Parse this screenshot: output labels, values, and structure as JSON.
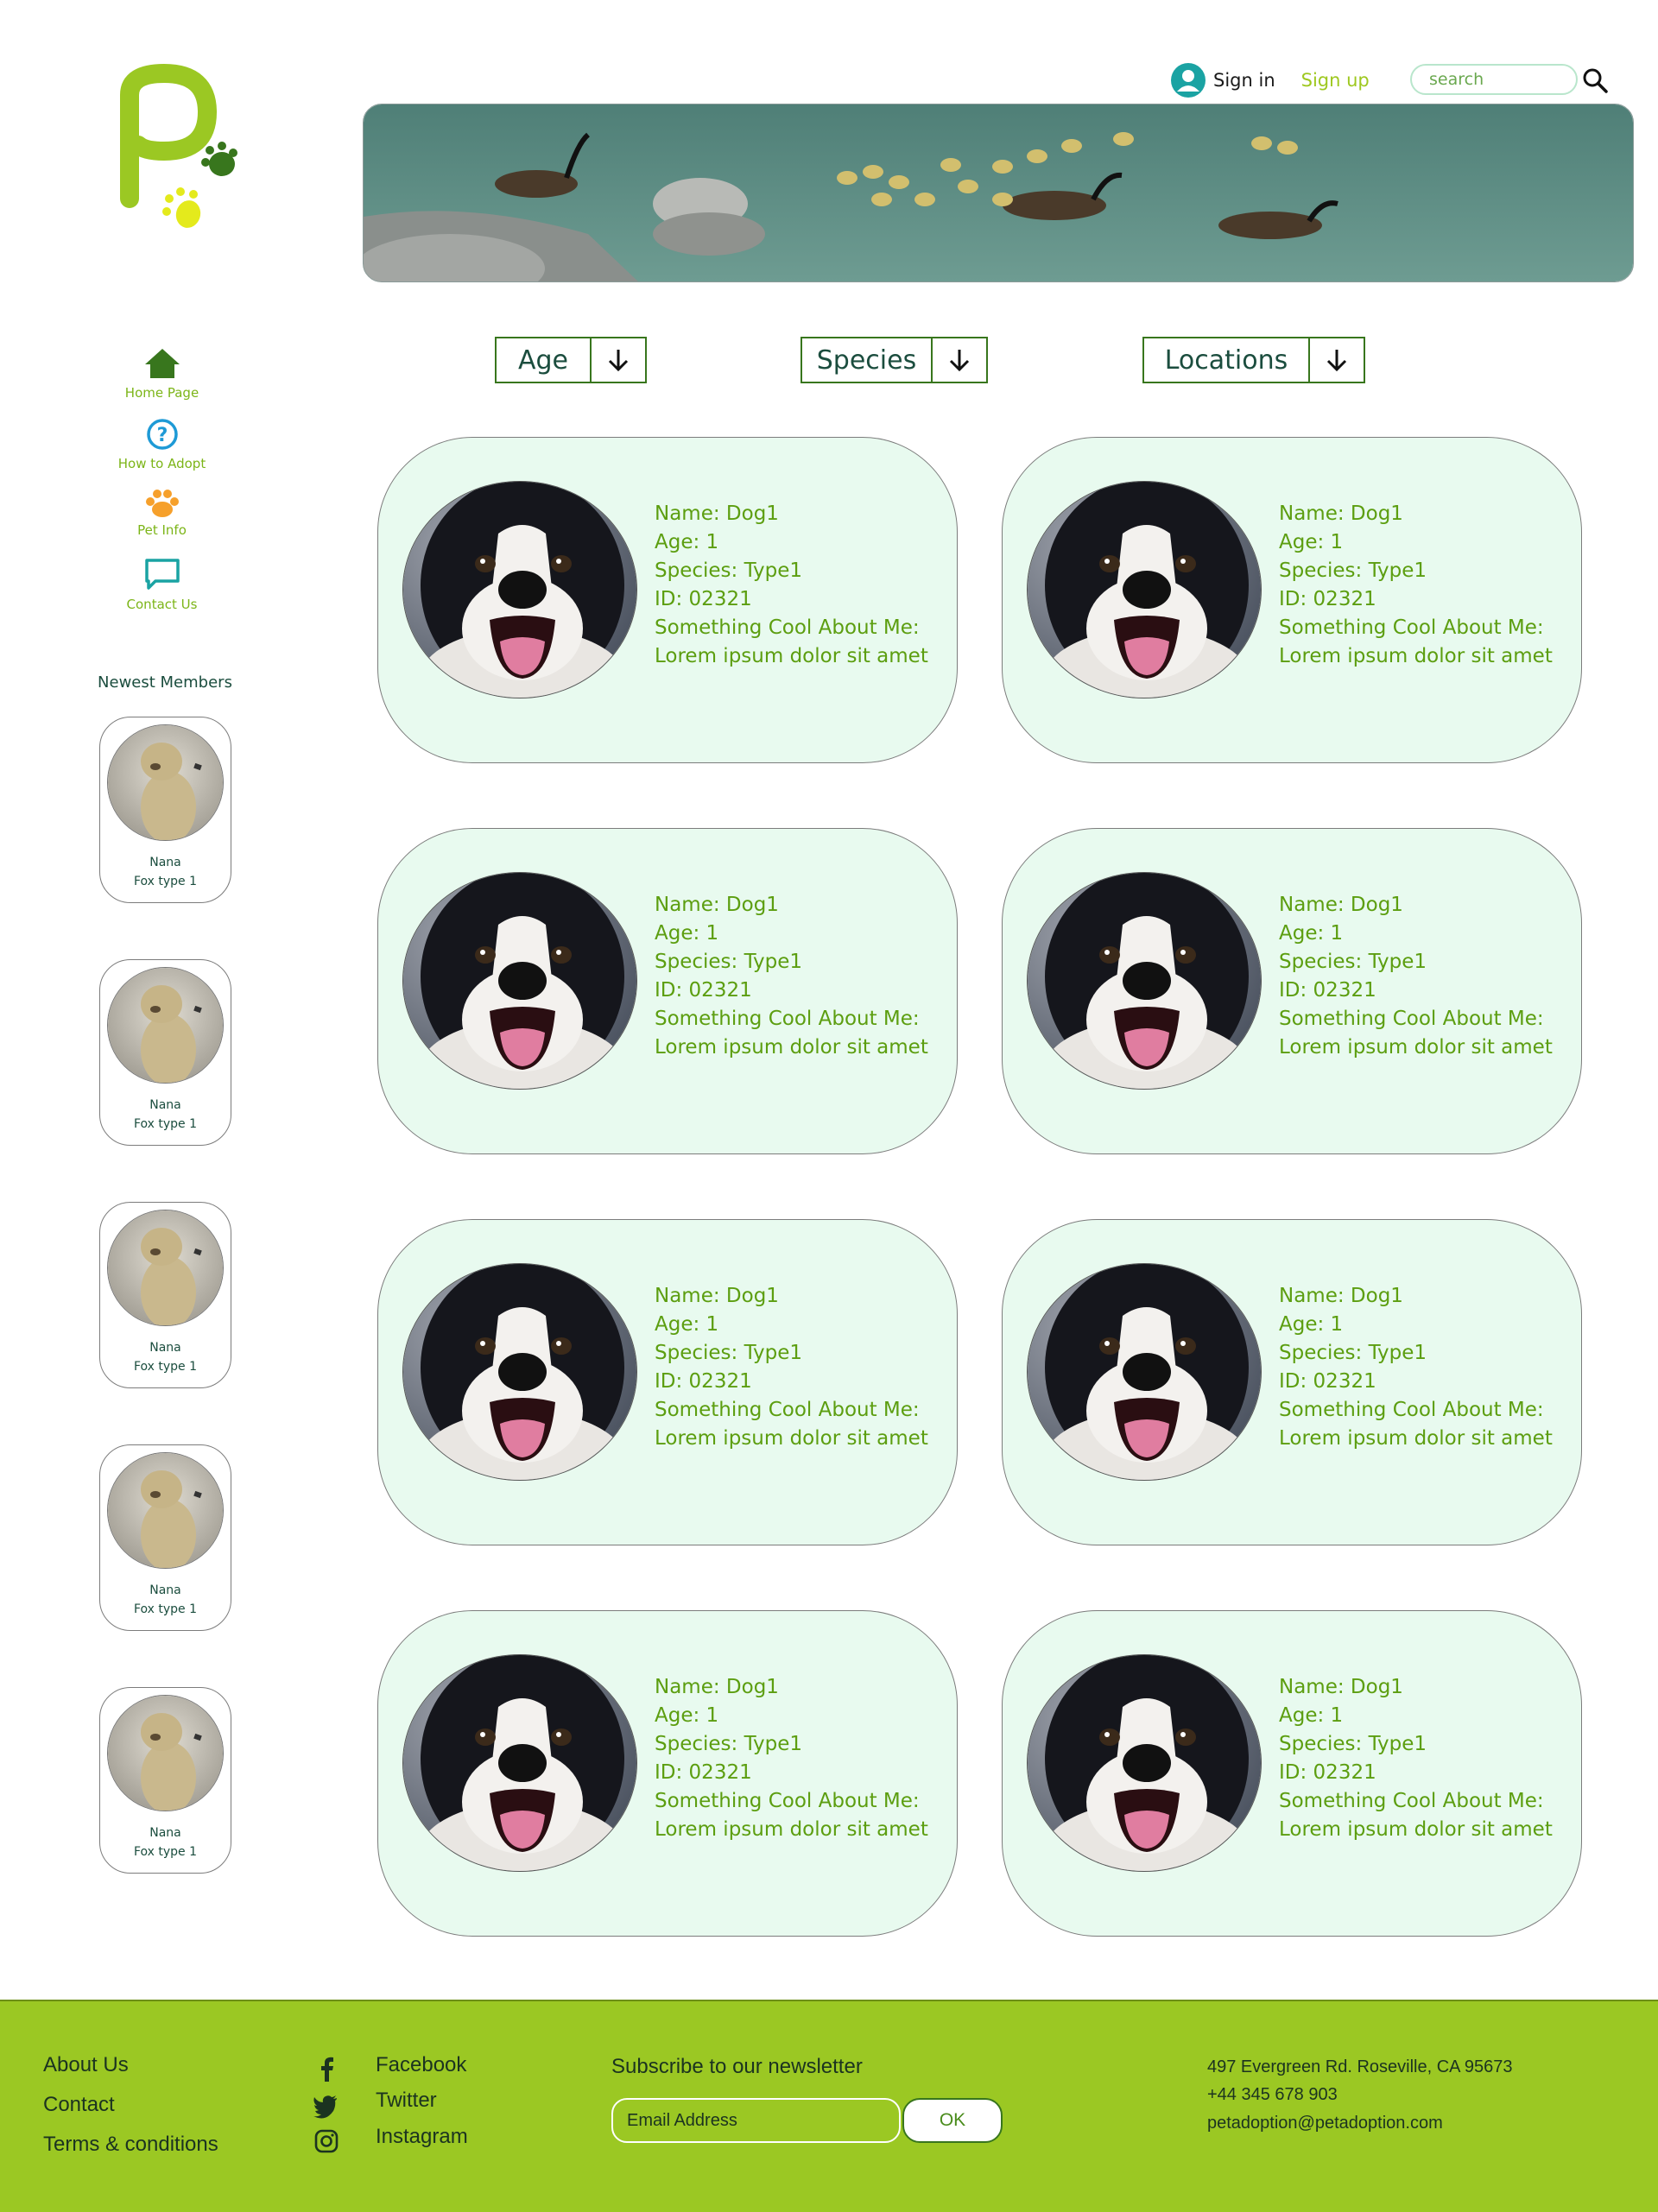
{
  "header": {
    "sign_in": "Sign in",
    "sign_up": "Sign up",
    "search_placeholder": "search"
  },
  "nav": [
    {
      "label": "Home Page",
      "icon": "home-icon",
      "color": "#38761d"
    },
    {
      "label": "How to Adopt",
      "icon": "question-icon",
      "color": "#1e9ad6"
    },
    {
      "label": "Pet Info",
      "icon": "paw-icon",
      "color": "#f6a02b"
    },
    {
      "label": "Contact Us",
      "icon": "chat-icon",
      "color": "#1aa3a3"
    }
  ],
  "newest_members": {
    "title": "Newest Members",
    "members": [
      {
        "name": "Nana",
        "type": "Fox type 1"
      },
      {
        "name": "Nana",
        "type": "Fox type 1"
      },
      {
        "name": "Nana",
        "type": "Fox type 1"
      },
      {
        "name": "Nana",
        "type": "Fox type 1"
      },
      {
        "name": "Nana",
        "type": "Fox type 1"
      }
    ]
  },
  "filters": [
    {
      "label": "Age"
    },
    {
      "label": "Species"
    },
    {
      "label": "Locations"
    }
  ],
  "pets": [
    {
      "name": "Name:  Dog1",
      "age": "Age:  1",
      "species": "Species: Type1",
      "id": "ID: 02321",
      "cool_title": "Something Cool About Me:",
      "cool_text": "Lorem ipsum dolor sit amet"
    },
    {
      "name": "Name:  Dog1",
      "age": "Age:  1",
      "species": "Species: Type1",
      "id": "ID: 02321",
      "cool_title": "Something Cool About Me:",
      "cool_text": "Lorem ipsum dolor sit amet"
    },
    {
      "name": "Name:  Dog1",
      "age": "Age:  1",
      "species": "Species: Type1",
      "id": "ID: 02321",
      "cool_title": "Something Cool About Me:",
      "cool_text": "Lorem ipsum dolor sit amet"
    },
    {
      "name": "Name:  Dog1",
      "age": "Age:  1",
      "species": "Species: Type1",
      "id": "ID: 02321",
      "cool_title": "Something Cool About Me:",
      "cool_text": "Lorem ipsum dolor sit amet"
    },
    {
      "name": "Name:  Dog1",
      "age": "Age:  1",
      "species": "Species: Type1",
      "id": "ID: 02321",
      "cool_title": "Something Cool About Me:",
      "cool_text": "Lorem ipsum dolor sit amet"
    },
    {
      "name": "Name:  Dog1",
      "age": "Age:  1",
      "species": "Species: Type1",
      "id": "ID: 02321",
      "cool_title": "Something Cool About Me:",
      "cool_text": "Lorem ipsum dolor sit amet"
    },
    {
      "name": "Name:  Dog1",
      "age": "Age:  1",
      "species": "Species: Type1",
      "id": "ID: 02321",
      "cool_title": "Something Cool About Me:",
      "cool_text": "Lorem ipsum dolor sit amet"
    },
    {
      "name": "Name:  Dog1",
      "age": "Age:  1",
      "species": "Species: Type1",
      "id": "ID: 02321",
      "cool_title": "Something Cool About Me:",
      "cool_text": "Lorem ipsum dolor sit amet"
    }
  ],
  "footer": {
    "links": [
      "About Us",
      "Contact",
      "Terms & conditions"
    ],
    "social": [
      {
        "label": "Facebook",
        "icon": "facebook-icon"
      },
      {
        "label": "Twitter",
        "icon": "twitter-icon"
      },
      {
        "label": "Instagram",
        "icon": "instagram-icon"
      }
    ],
    "newsletter_title": "Subscribe to our newsletter",
    "email_placeholder": "Email Address",
    "ok_label": "OK",
    "address": "497 Evergreen Rd. Roseville, CA 95673",
    "phone": "+44 345 678 903",
    "email": "petadoption@petadoption.com"
  },
  "colors": {
    "accent_green": "#9bc823",
    "card_bg": "#e8faef",
    "text_green": "#5c9e10",
    "dark_green": "#1b4d3e"
  }
}
